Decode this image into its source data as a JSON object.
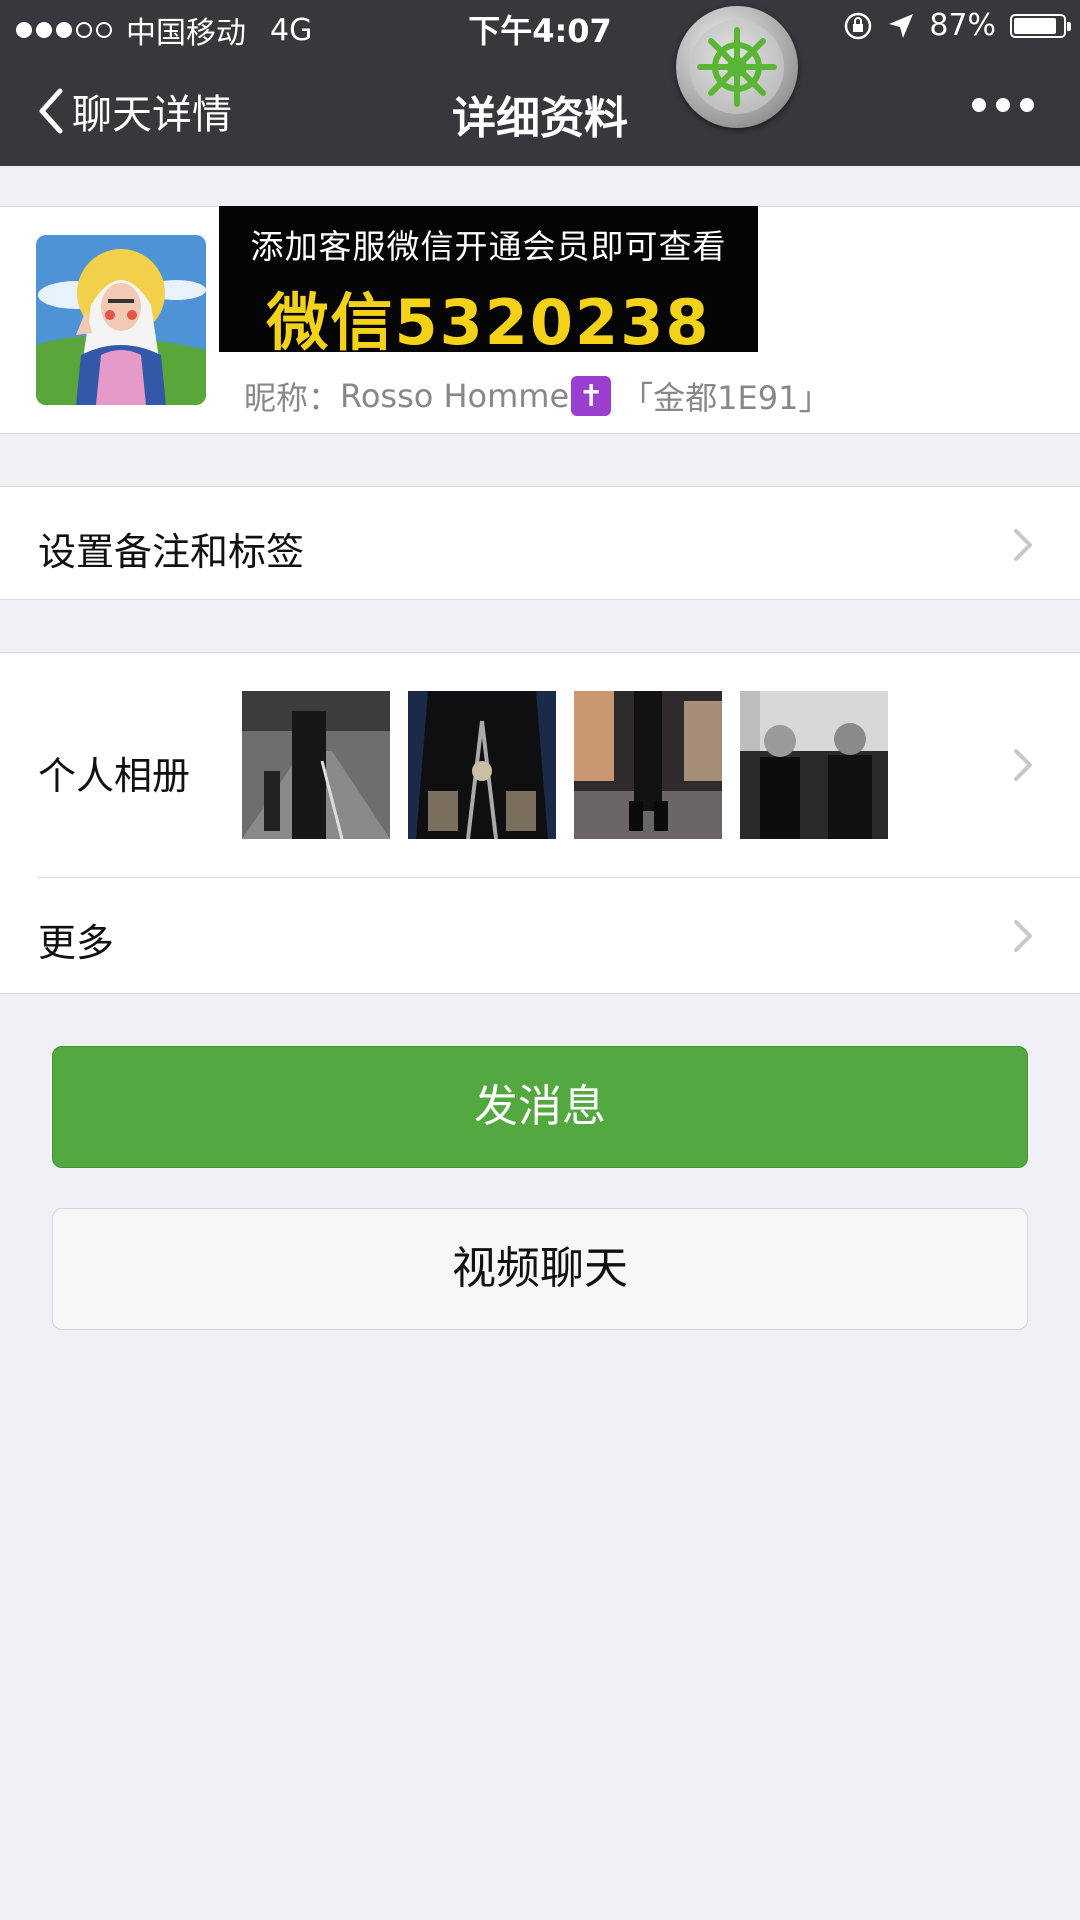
{
  "status_bar": {
    "carrier": "中国移动",
    "network": "4G",
    "time": "下午4:07",
    "battery": "87%",
    "battery_level": 0.87
  },
  "nav": {
    "back_label": "聊天详情",
    "title": "详细资料"
  },
  "profile": {
    "ad_line1": "添加客服微信开通会员即可查看",
    "ad_line2": "微信5320238",
    "nickname_label": "昵称：",
    "nickname_value": "Rosso Homme",
    "nickname_suffix": "「金都1E91」"
  },
  "rows": {
    "remark": "设置备注和标签",
    "album": "个人相册",
    "more": "更多"
  },
  "buttons": {
    "send_message": "发消息",
    "video_chat": "视频聊天"
  },
  "colors": {
    "primary_green": "#53a93f",
    "ad_yellow": "#f5d21a",
    "nav_bg": "#37373c"
  }
}
